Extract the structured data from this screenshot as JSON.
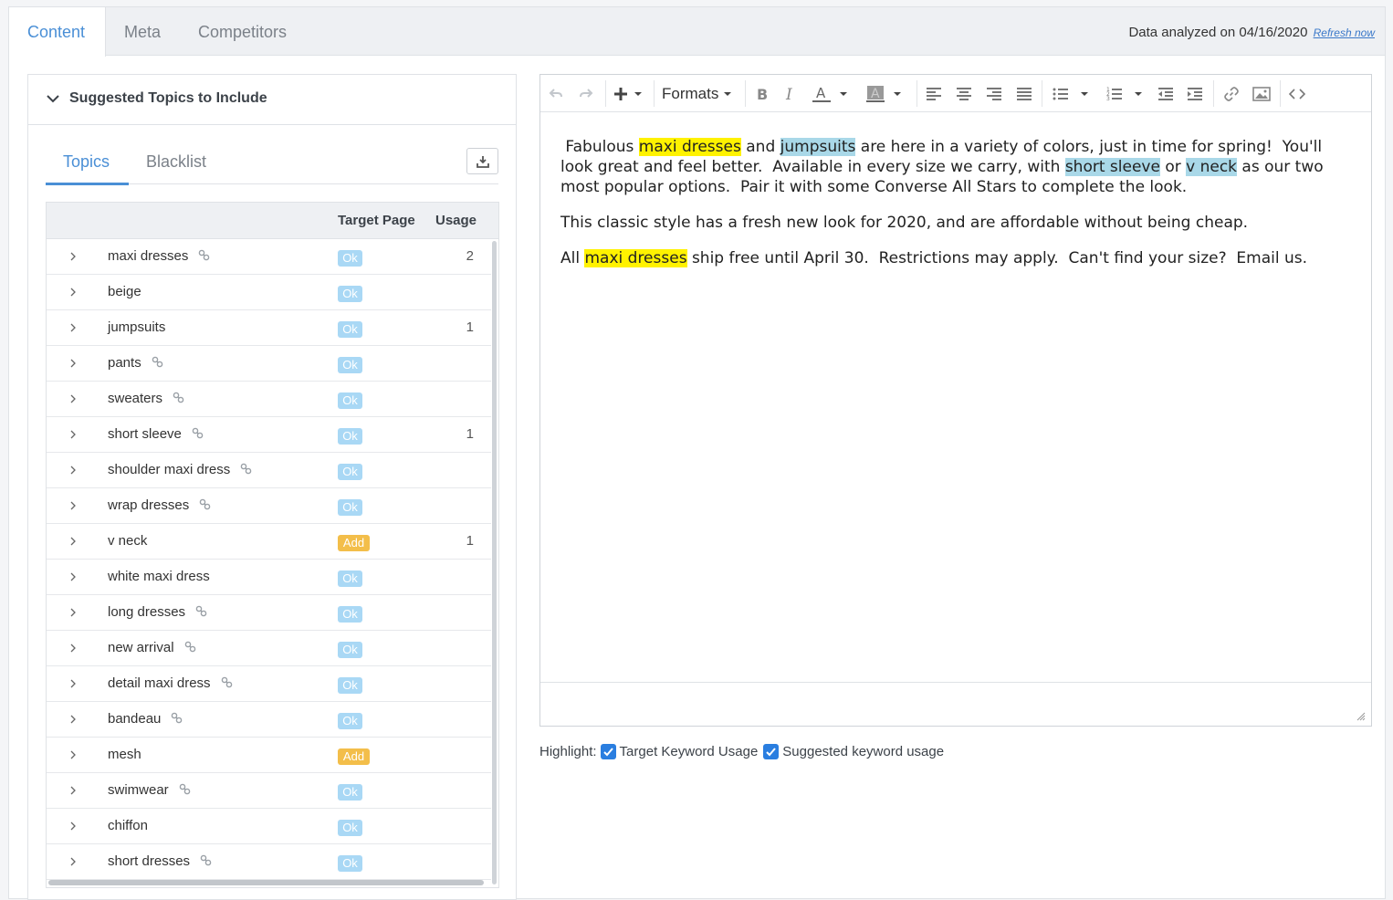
{
  "tabs": [
    {
      "label": "Content",
      "active": true
    },
    {
      "label": "Meta",
      "active": false
    },
    {
      "label": "Competitors",
      "active": false
    }
  ],
  "analyzed": {
    "text": "Data analyzed on 04/16/2020",
    "refresh_label": "Refresh now"
  },
  "panel": {
    "title": "Suggested Topics to Include",
    "subtabs": [
      "Topics",
      "Blacklist"
    ],
    "download_icon": "download-icon",
    "columns": {
      "target": "Target Page",
      "usage": "Usage"
    },
    "rows": [
      {
        "keyword": "maxi dresses",
        "link": true,
        "status": "Ok",
        "usage": "2"
      },
      {
        "keyword": "beige",
        "link": false,
        "status": "Ok",
        "usage": ""
      },
      {
        "keyword": "jumpsuits",
        "link": false,
        "status": "Ok",
        "usage": "1"
      },
      {
        "keyword": "pants",
        "link": true,
        "status": "Ok",
        "usage": ""
      },
      {
        "keyword": "sweaters",
        "link": true,
        "status": "Ok",
        "usage": ""
      },
      {
        "keyword": "short sleeve",
        "link": true,
        "status": "Ok",
        "usage": "1"
      },
      {
        "keyword": "shoulder maxi dress",
        "link": true,
        "status": "Ok",
        "usage": ""
      },
      {
        "keyword": "wrap dresses",
        "link": true,
        "status": "Ok",
        "usage": ""
      },
      {
        "keyword": "v neck",
        "link": false,
        "status": "Add",
        "usage": "1"
      },
      {
        "keyword": "white maxi dress",
        "link": false,
        "status": "Ok",
        "usage": ""
      },
      {
        "keyword": "long dresses",
        "link": true,
        "status": "Ok",
        "usage": ""
      },
      {
        "keyword": "new arrival",
        "link": true,
        "status": "Ok",
        "usage": ""
      },
      {
        "keyword": "detail maxi dress",
        "link": true,
        "status": "Ok",
        "usage": ""
      },
      {
        "keyword": "bandeau",
        "link": true,
        "status": "Ok",
        "usage": ""
      },
      {
        "keyword": "mesh",
        "link": false,
        "status": "Add",
        "usage": ""
      },
      {
        "keyword": "swimwear",
        "link": true,
        "status": "Ok",
        "usage": ""
      },
      {
        "keyword": "chiffon",
        "link": false,
        "status": "Ok",
        "usage": ""
      },
      {
        "keyword": "short dresses",
        "link": true,
        "status": "Ok",
        "usage": ""
      }
    ]
  },
  "editor": {
    "formats_label": "Formats",
    "paragraphs": [
      [
        {
          "t": " Fabulous "
        },
        {
          "t": "maxi dresses",
          "hl": "y"
        },
        {
          "t": " and "
        },
        {
          "t": "jumpsuits",
          "hl": "b"
        },
        {
          "t": " are here in a variety of colors, just in time for spring!  You'll look great and feel better.  Available in every size we carry, with "
        },
        {
          "t": "short sleeve",
          "hl": "b"
        },
        {
          "t": " or "
        },
        {
          "t": "v neck",
          "hl": "b"
        },
        {
          "t": " as our two most popular options.  Pair it with some Converse All Stars to complete the look."
        }
      ],
      [
        {
          "t": "This classic style has a fresh new look for 2020, and are affordable without being cheap."
        }
      ],
      [
        {
          "t": "All "
        },
        {
          "t": "maxi dresses",
          "hl": "y"
        },
        {
          "t": " ship free until April 30.  Restrictions may apply.  Can't find your size?  Email us."
        }
      ]
    ]
  },
  "highlight": {
    "label": "Highlight:",
    "options": [
      {
        "label": "Target Keyword Usage",
        "checked": true
      },
      {
        "label": "Suggested keyword usage",
        "checked": true
      }
    ]
  },
  "colors": {
    "accent": "#4a8fd6",
    "ok_badge": "#a9d8f5",
    "add_badge": "#f3be4a",
    "highlight_target": "#fff200",
    "highlight_suggested": "#a9d8e8"
  }
}
